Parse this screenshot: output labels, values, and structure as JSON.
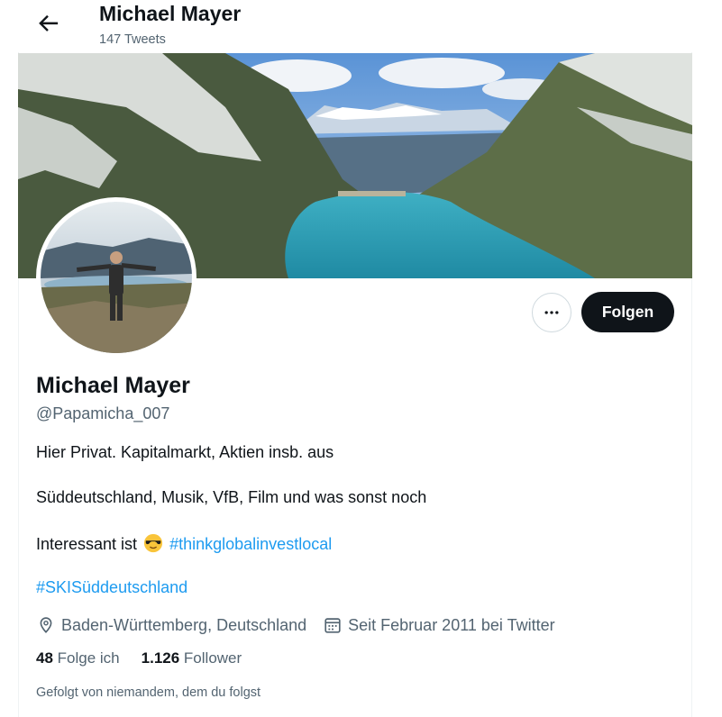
{
  "header": {
    "title": "Michael Mayer",
    "tweet_count": "147 Tweets",
    "back_icon": "arrow-left-icon"
  },
  "profile": {
    "name": "Michael Mayer",
    "handle": "@Papamicha_007",
    "bio": {
      "line1": "Hier Privat. Kapitalmarkt, Aktien insb. aus",
      "line2": "Süddeutschland, Musik, VfB, Film und was sonst noch",
      "line3_text": "Interessant ist",
      "line3_emoji": "sunglasses-emoji",
      "hashtag1": "#thinkglobalinvestlocal",
      "hashtag2": "#SKISüddeutschland"
    },
    "location": "Baden-Württemberg, Deutschland",
    "location_icon": "location-pin-icon",
    "joined": "Seit Februar 2011 bei Twitter",
    "joined_icon": "calendar-icon",
    "following_count": "48",
    "following_label": "Folge ich",
    "followers_count": "1.126",
    "followers_label": "Follower",
    "followed_by": "Gefolgt von niemandem, dem du folgst"
  },
  "actions": {
    "more_icon": "more-horizontal-icon",
    "follow_label": "Folgen"
  },
  "colors": {
    "accent": "#1d9bf0",
    "text": "#0f1419",
    "secondary": "#536471",
    "follow_bg": "#0f1419"
  }
}
